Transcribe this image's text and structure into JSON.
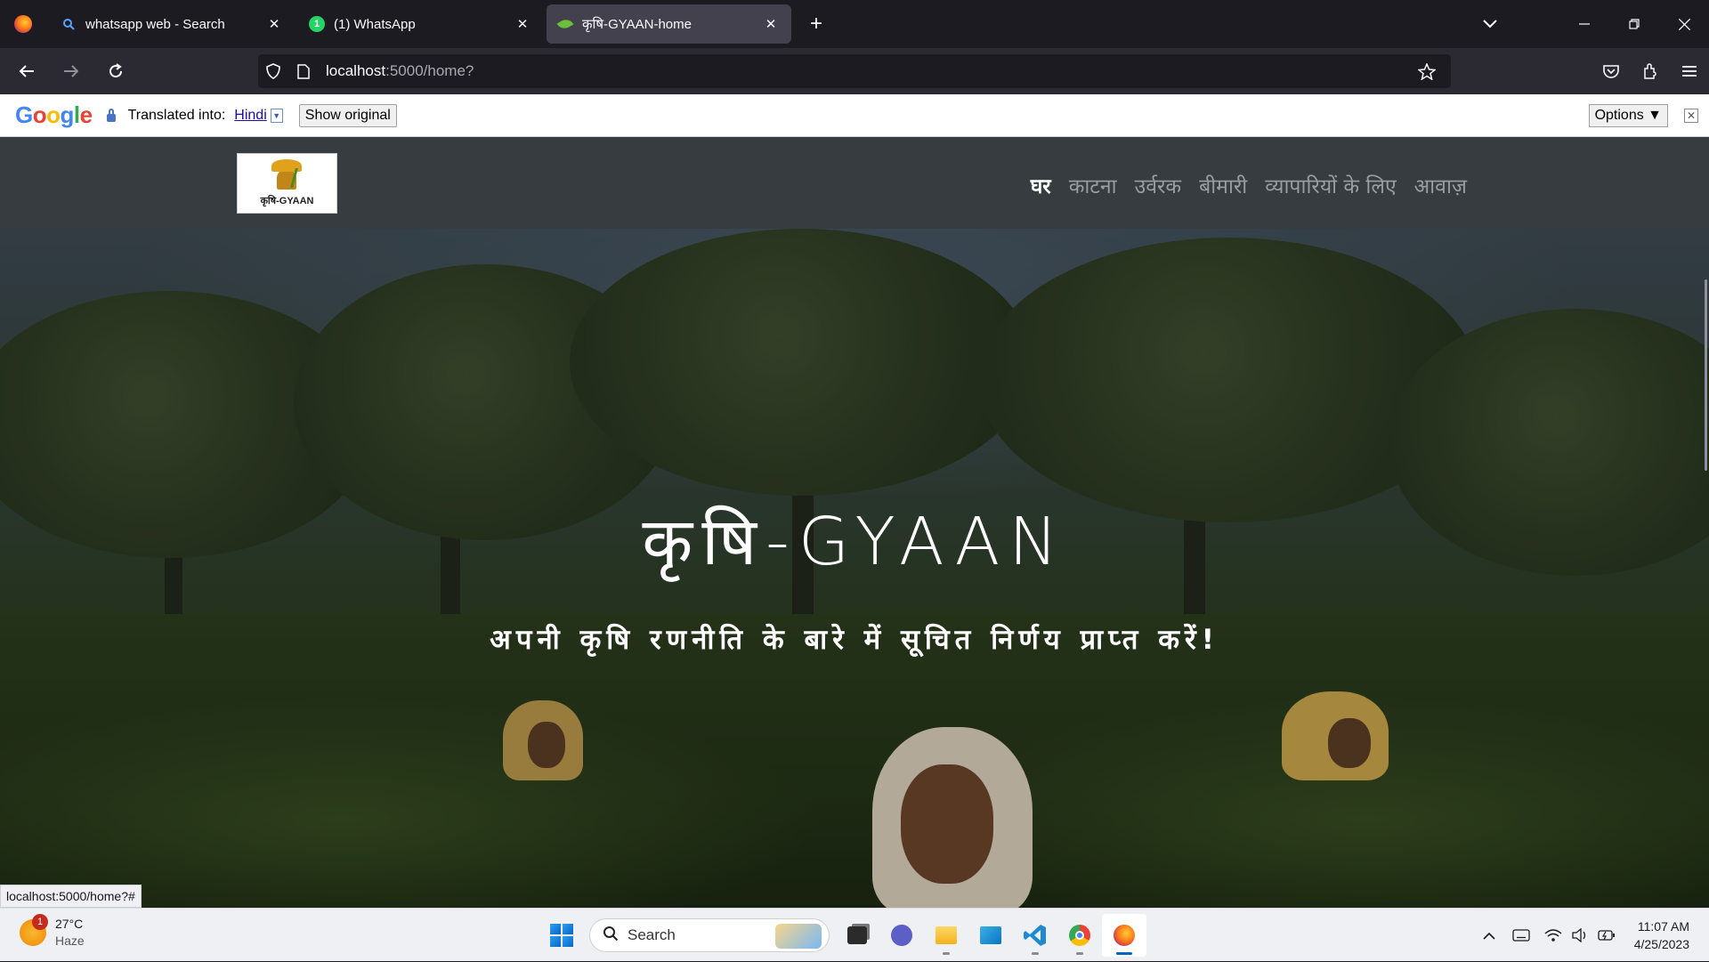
{
  "browser": {
    "tabs": [
      {
        "title": "whatsapp web - Search",
        "icon": "search-icon"
      },
      {
        "title": "(1) WhatsApp",
        "icon": "whatsapp-icon"
      },
      {
        "title": "कृषि-GYAAN-home",
        "icon": "leaf-icon",
        "active": true
      }
    ],
    "new_tab": "+",
    "url_host": "localhost",
    "url_path": ":5000/home?"
  },
  "translate_bar": {
    "logo": [
      "G",
      "o",
      "o",
      "g",
      "l",
      "e"
    ],
    "translated_into_label": "Translated into:",
    "language": "Hindi",
    "show_original": "Show original",
    "options": "Options ▼"
  },
  "site": {
    "logo_text": "कृषि-GYAAN",
    "nav": [
      {
        "label": "घर",
        "active": true
      },
      {
        "label": "काटना"
      },
      {
        "label": "उर्वरक"
      },
      {
        "label": "बीमारी"
      },
      {
        "label": "व्यापारियों के लिए"
      },
      {
        "label": "आवाज़"
      }
    ],
    "hero_title": "कृषि-GYAAN",
    "hero_subtitle": "अपनी कृषि रणनीति के बारे में सूचित निर्णय प्राप्त करें!"
  },
  "status_url": "localhost:5000/home?#",
  "taskbar": {
    "weather_temp": "27°C",
    "weather_cond": "Haze",
    "weather_badge": "1",
    "search_label": "Search",
    "time": "11:07 AM",
    "date": "4/25/2023"
  },
  "colors": {
    "accent": "#0067c0",
    "header_bg": "#373c41",
    "browser_bg": "#1c1b22"
  }
}
